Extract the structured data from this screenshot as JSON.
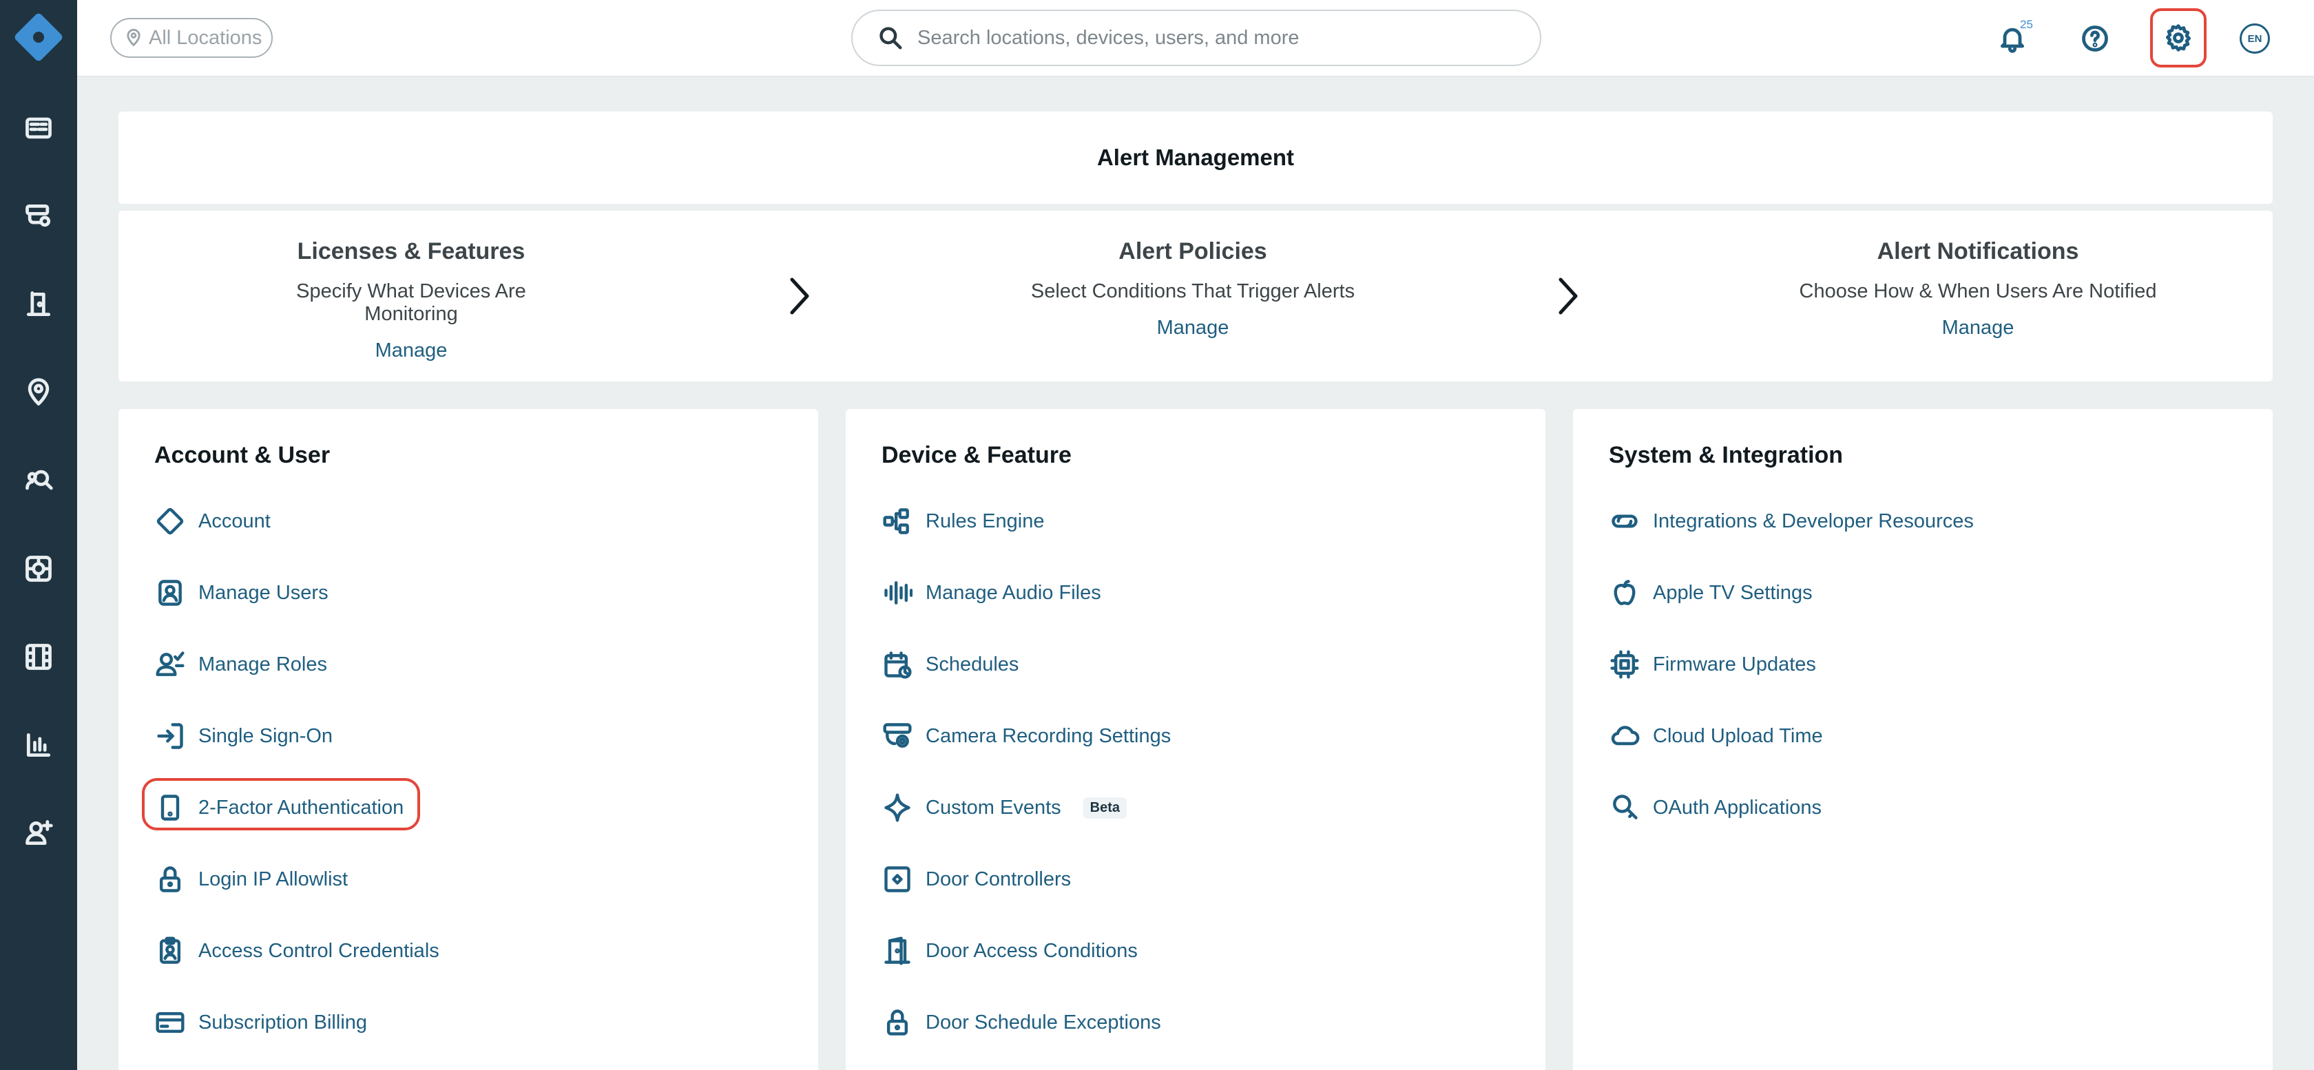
{
  "topbar": {
    "location_filter": "All Locations",
    "search_placeholder": "Search locations, devices, users, and more",
    "notification_count": "25",
    "language": "EN"
  },
  "alert_management": {
    "title": "Alert Management",
    "steps": [
      {
        "title": "Licenses & Features",
        "subtitle": "Specify What Devices Are Monitoring",
        "link": "Manage"
      },
      {
        "title": "Alert Policies",
        "subtitle": "Select Conditions That Trigger Alerts",
        "link": "Manage"
      },
      {
        "title": "Alert Notifications",
        "subtitle": "Choose How & When Users Are Notified",
        "link": "Manage"
      }
    ]
  },
  "columns": [
    {
      "title": "Account & User",
      "items": [
        {
          "label": "Account",
          "icon": "diamond-icon"
        },
        {
          "label": "Manage Users",
          "icon": "user-card-icon"
        },
        {
          "label": "Manage Roles",
          "icon": "user-check-icon"
        },
        {
          "label": "Single Sign-On",
          "icon": "sign-in-icon"
        },
        {
          "label": "2-Factor Authentication",
          "icon": "phone-icon"
        },
        {
          "label": "Login IP Allowlist",
          "icon": "lock-icon"
        },
        {
          "label": "Access Control Credentials",
          "icon": "badge-icon"
        },
        {
          "label": "Subscription Billing",
          "icon": "credit-card-icon"
        }
      ]
    },
    {
      "title": "Device & Feature",
      "items": [
        {
          "label": "Rules Engine",
          "icon": "flow-icon"
        },
        {
          "label": "Manage Audio Files",
          "icon": "audio-wave-icon"
        },
        {
          "label": "Schedules",
          "icon": "calendar-clock-icon"
        },
        {
          "label": "Camera Recording Settings",
          "icon": "camera-gear-icon"
        },
        {
          "label": "Custom Events",
          "icon": "sparkle-icon",
          "badge": "Beta"
        },
        {
          "label": "Door Controllers",
          "icon": "door-controller-icon"
        },
        {
          "label": "Door Access Conditions",
          "icon": "door-icon"
        },
        {
          "label": "Door Schedule Exceptions",
          "icon": "lock-icon"
        }
      ]
    },
    {
      "title": "System & Integration",
      "items": [
        {
          "label": "Integrations & Developer Resources",
          "icon": "link-icon"
        },
        {
          "label": "Apple TV Settings",
          "icon": "apple-icon"
        },
        {
          "label": "Firmware Updates",
          "icon": "chip-icon"
        },
        {
          "label": "Cloud Upload Time",
          "icon": "cloud-icon"
        },
        {
          "label": "OAuth Applications",
          "icon": "key-icon"
        }
      ]
    }
  ],
  "colors": {
    "sidebar": "#1f3440",
    "accent": "#1f5e80",
    "highlight": "#e3463a",
    "logo": "#3e8fd4"
  }
}
